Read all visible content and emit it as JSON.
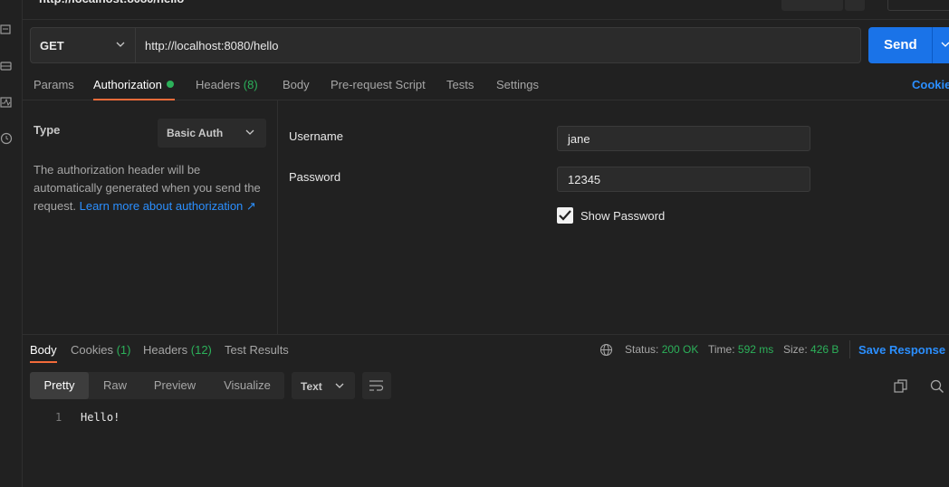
{
  "request": {
    "method": "GET",
    "url": "http://localhost:8080/hello",
    "send_label": "Send"
  },
  "request_tabs": [
    {
      "label": "Params"
    },
    {
      "label": "Authorization"
    },
    {
      "label": "Headers",
      "count": "(8)"
    },
    {
      "label": "Body"
    },
    {
      "label": "Pre-request Script"
    },
    {
      "label": "Tests"
    },
    {
      "label": "Settings"
    }
  ],
  "cookies_link": "Cookies",
  "auth": {
    "type_label": "Type",
    "type_value": "Basic Auth",
    "description": "The authorization header will be automatically generated when you send the request.",
    "learn_more": "Learn more about authorization ↗",
    "username_label": "Username",
    "username_value": "jane",
    "password_label": "Password",
    "password_value": "12345",
    "show_password_label": "Show Password",
    "show_password_checked": true
  },
  "response": {
    "tabs": [
      {
        "label": "Body"
      },
      {
        "label": "Cookies",
        "count": "(1)"
      },
      {
        "label": "Headers",
        "count": "(12)"
      },
      {
        "label": "Test Results"
      }
    ],
    "status_label": "Status:",
    "status_value": "200 OK",
    "time_label": "Time:",
    "time_value": "592 ms",
    "size_label": "Size:",
    "size_value": "426 B",
    "save_label": "Save Response",
    "view_modes": [
      "Pretty",
      "Raw",
      "Preview",
      "Visualize"
    ],
    "format": "Text",
    "lines": [
      {
        "n": "1",
        "text": "Hello!"
      }
    ]
  },
  "colors": {
    "accent_blue": "#1a73e8",
    "success_green": "#2cb15a",
    "active_tab_orange": "#f26b3a"
  }
}
